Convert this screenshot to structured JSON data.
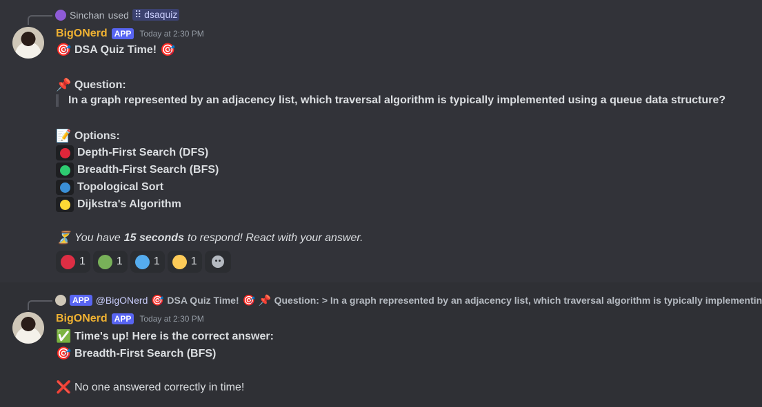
{
  "colors": {
    "red": "#e0263a",
    "green": "#2ecc71",
    "blue": "#3a8fd6",
    "yellow": "#fdd835",
    "react_green": "#78b159",
    "react_blue": "#55acee",
    "react_yellow": "#fdcb58",
    "author": "#f0b232",
    "app_badge": "#5865f2"
  },
  "message1": {
    "reply": {
      "user": "Sinchan",
      "verb": "used",
      "command": "dsaquiz"
    },
    "author": "BigONerd",
    "app_badge": "APP",
    "timestamp": "Today at 2:30 PM",
    "title": "DSA Quiz Time!",
    "question_label": "Question:",
    "question_text": "In a graph represented by an adjacency list, which traversal algorithm is typically implemented using a queue data structure?",
    "options_label": "Options:",
    "options": [
      {
        "label": "Depth-First Search (DFS)",
        "color_key": "red"
      },
      {
        "label": "Breadth-First Search (BFS)",
        "color_key": "green"
      },
      {
        "label": "Topological Sort",
        "color_key": "blue"
      },
      {
        "label": "Dijkstra's Algorithm",
        "color_key": "yellow"
      }
    ],
    "timer": {
      "prefix": "You have",
      "emphasis": "15 seconds",
      "suffix": "to respond! React with your answer."
    },
    "reactions": [
      {
        "icon": "red-circle-icon",
        "count": "1"
      },
      {
        "icon": "green-circle-icon",
        "count": "1"
      },
      {
        "icon": "blue-circle-icon",
        "count": "1"
      },
      {
        "icon": "yellow-circle-icon",
        "count": "1"
      }
    ]
  },
  "message2": {
    "reply": {
      "badge": "APP",
      "mention": "@BigONerd",
      "title": "DSA Quiz Time!",
      "snippet": "Question: > In a graph represented by an adjacency list, which traversal algorithm is typically implementing"
    },
    "author": "BigONerd",
    "app_badge": "APP",
    "timestamp": "Today at 2:30 PM",
    "line1": "Time's up! Here is the correct answer:",
    "line2": "Breadth-First Search (BFS)",
    "line3": "No one answered correctly in time!"
  }
}
